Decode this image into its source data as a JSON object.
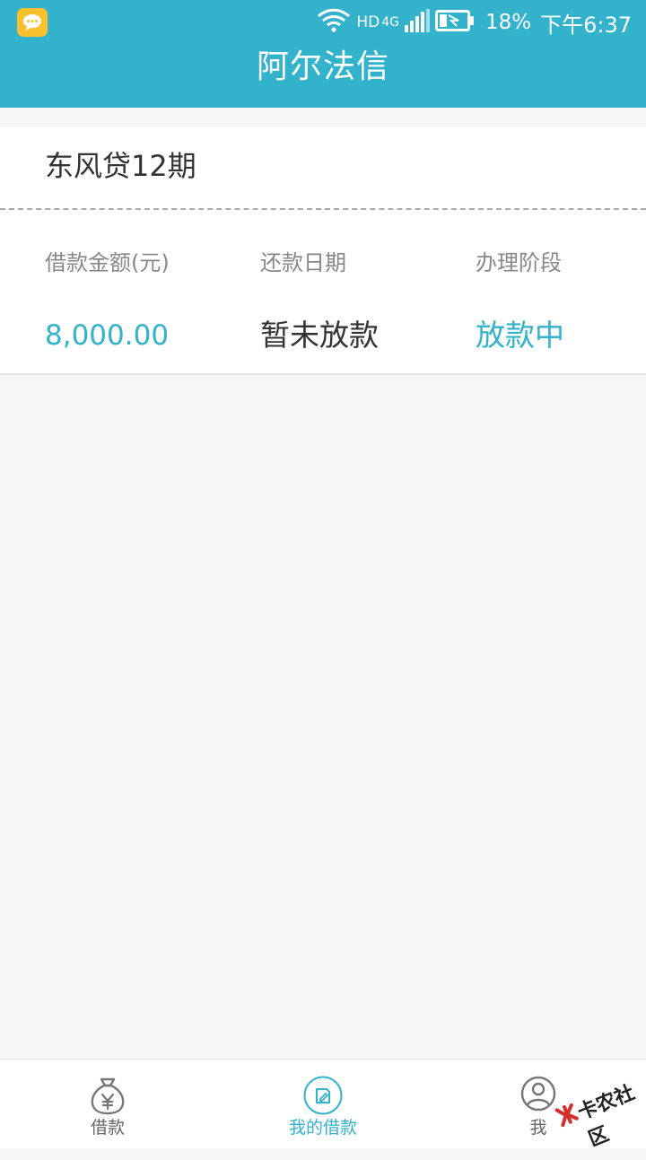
{
  "status_bar": {
    "hd": "HD",
    "network": "4G",
    "battery_percent": "18%",
    "time": "下午6:37"
  },
  "header": {
    "title": "阿尔法信"
  },
  "loan": {
    "product_name": "东风贷12期",
    "columns": [
      {
        "label": "借款金额(元)",
        "value": "8,000.00"
      },
      {
        "label": "还款日期",
        "value": "暂未放款"
      },
      {
        "label": "办理阶段",
        "value": "放款中"
      }
    ]
  },
  "bottom_nav": {
    "items": [
      {
        "label": "借款",
        "icon": "money-bag-icon",
        "active": false
      },
      {
        "label": "我的借款",
        "icon": "document-icon",
        "active": true
      },
      {
        "label": "我",
        "icon": "user-icon",
        "active": false
      }
    ]
  },
  "watermark": {
    "text": "卡农社区"
  },
  "colors": {
    "accent": "#32b2cb",
    "notification": "#fbc02d"
  }
}
